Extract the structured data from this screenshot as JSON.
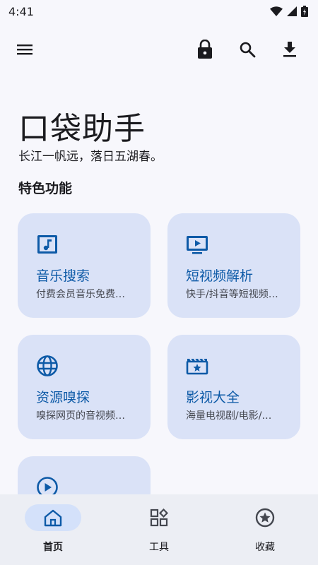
{
  "status_bar": {
    "time": "4:41",
    "icons": [
      "wifi-icon",
      "cellular-signal-icon",
      "battery-icon"
    ]
  },
  "app_bar": {
    "icons": [
      "menu-icon",
      "lock-icon",
      "search-icon",
      "download-icon"
    ]
  },
  "hero": {
    "title": "口袋助手",
    "subtitle": "长江一帆远，落日五湖春。"
  },
  "features": {
    "section_title": "特色功能",
    "cards": [
      {
        "icon": "music-note-icon",
        "title": "音乐搜索",
        "description": "付费会员音乐免费…"
      },
      {
        "icon": "tv-play-icon",
        "title": "短视频解析",
        "description": "快手/抖音等短视频…"
      },
      {
        "icon": "globe-icon",
        "title": "资源嗅探",
        "description": "嗅探网页的音视频…"
      },
      {
        "icon": "movie-icon",
        "title": "影视大全",
        "description": "海量电视剧/电影/…"
      },
      {
        "icon": "play-circle-icon",
        "title": "",
        "description": ""
      }
    ]
  },
  "bottom_nav": {
    "items": [
      {
        "label": "首页",
        "icon": "home-icon",
        "active": true
      },
      {
        "label": "工具",
        "icon": "widgets-icon",
        "active": false
      },
      {
        "label": "收藏",
        "icon": "star-circle-icon",
        "active": false
      }
    ]
  },
  "colors": {
    "background": "#f7f7fc",
    "card": "#dae2f7",
    "accent": "#0d5aa7",
    "nav_background": "#eceef4",
    "nav_active_pill": "#d4e1fa"
  }
}
